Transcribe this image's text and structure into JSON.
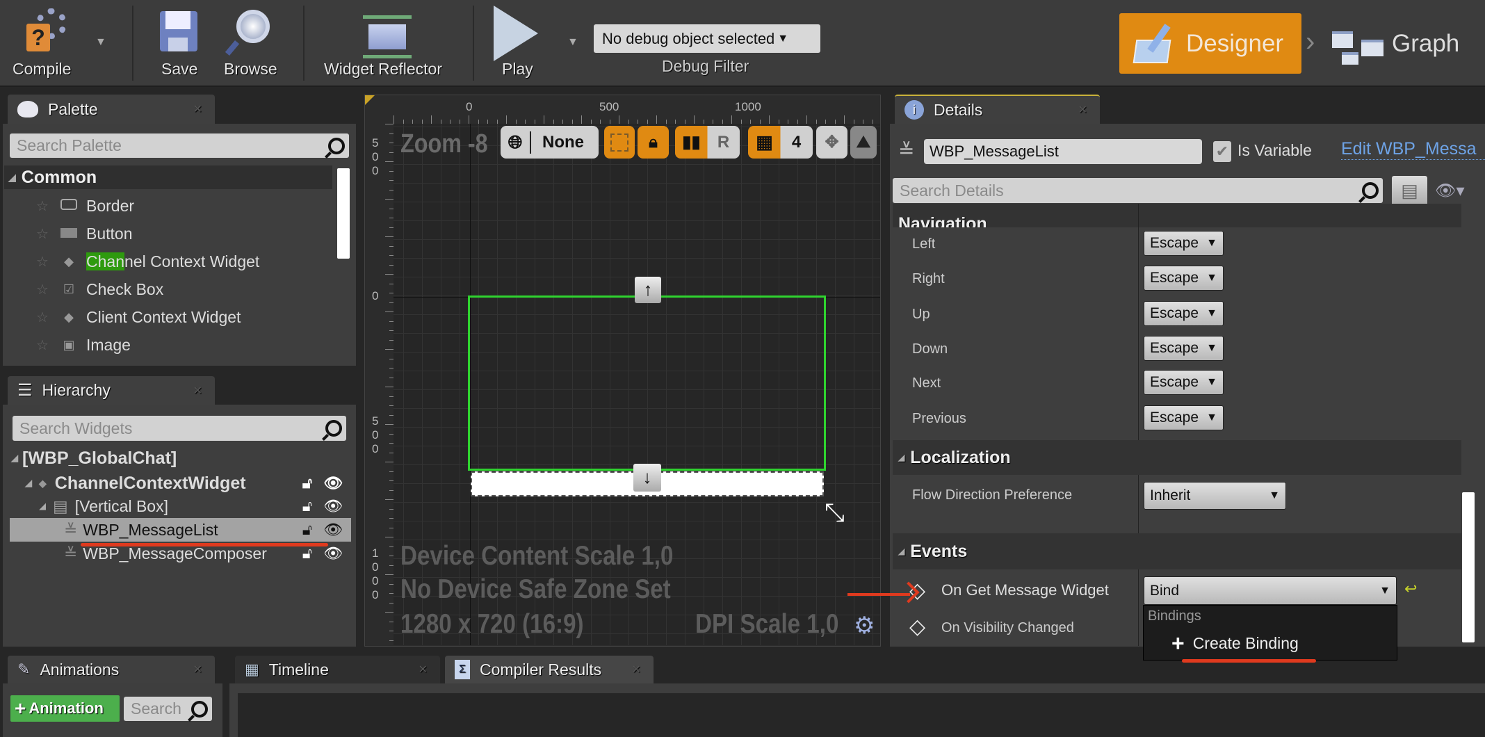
{
  "toolbar": {
    "compile": "Compile",
    "save": "Save",
    "browse": "Browse",
    "widget_reflector": "Widget Reflector",
    "play": "Play",
    "debug_object": "No debug object selected",
    "debug_filter": "Debug Filter",
    "mode_designer": "Designer",
    "mode_graph": "Graph",
    "accent_color": "#e08a12"
  },
  "palette": {
    "tab": "Palette",
    "search_placeholder": "Search Palette",
    "category": "Common",
    "items": [
      {
        "label": "Border",
        "icon": "border-icon"
      },
      {
        "label": "Button",
        "icon": "button-icon"
      },
      {
        "label_highlight": "Chan",
        "label_rest": "nel Context Widget",
        "icon": "widget-dot-icon"
      },
      {
        "label": "Check Box",
        "icon": "checkbox-icon"
      },
      {
        "label": "Client Context Widget",
        "icon": "widget-dot-icon"
      },
      {
        "label": "Image",
        "icon": "image-icon"
      }
    ]
  },
  "hierarchy": {
    "tab": "Hierarchy",
    "search_placeholder": "Search Widgets",
    "root": "[WBP_GlobalChat]",
    "nodes": [
      {
        "label": "ChannelContextWidget"
      },
      {
        "label": "[Vertical Box]"
      },
      {
        "label": "WBP_MessageList",
        "selected": true
      },
      {
        "label": "WBP_MessageComposer"
      }
    ]
  },
  "viewport": {
    "ruler_top": [
      "0",
      "500",
      "1000"
    ],
    "ruler_left": [
      "500",
      "0",
      "500",
      "1000"
    ],
    "zoom": "Zoom -8",
    "localization_mode": "None",
    "r_label": "R",
    "grid_snap": "4",
    "device_content_scale": "Device Content Scale 1,0",
    "safe_zone": "No Device Safe Zone Set",
    "resolution": "1280 x 720 (16:9)",
    "dpi_scale": "DPI Scale 1,0"
  },
  "details": {
    "tab": "Details",
    "name_value": "WBP_MessageList",
    "is_variable_label": "Is Variable",
    "is_variable": true,
    "edit_link": "Edit WBP_Messa",
    "search_placeholder": "Search Details",
    "navigation_header": "Navigation",
    "navigation": [
      {
        "label": "Left",
        "value": "Escape"
      },
      {
        "label": "Right",
        "value": "Escape"
      },
      {
        "label": "Up",
        "value": "Escape"
      },
      {
        "label": "Down",
        "value": "Escape"
      },
      {
        "label": "Next",
        "value": "Escape"
      },
      {
        "label": "Previous",
        "value": "Escape"
      }
    ],
    "localization_header": "Localization",
    "flow_direction_label": "Flow Direction Preference",
    "flow_direction_value": "Inherit",
    "events_header": "Events",
    "events": [
      {
        "label": "On Get Message Widget",
        "value": "Bind"
      },
      {
        "label": "On Visibility Changed"
      }
    ],
    "menu": {
      "section": "Bindings",
      "create": "Create Binding"
    }
  },
  "bottom": {
    "animations_tab": "Animations",
    "add_animation": "Animation",
    "anim_search_placeholder": "Search",
    "timeline_tab": "Timeline",
    "compiler_tab": "Compiler Results"
  }
}
